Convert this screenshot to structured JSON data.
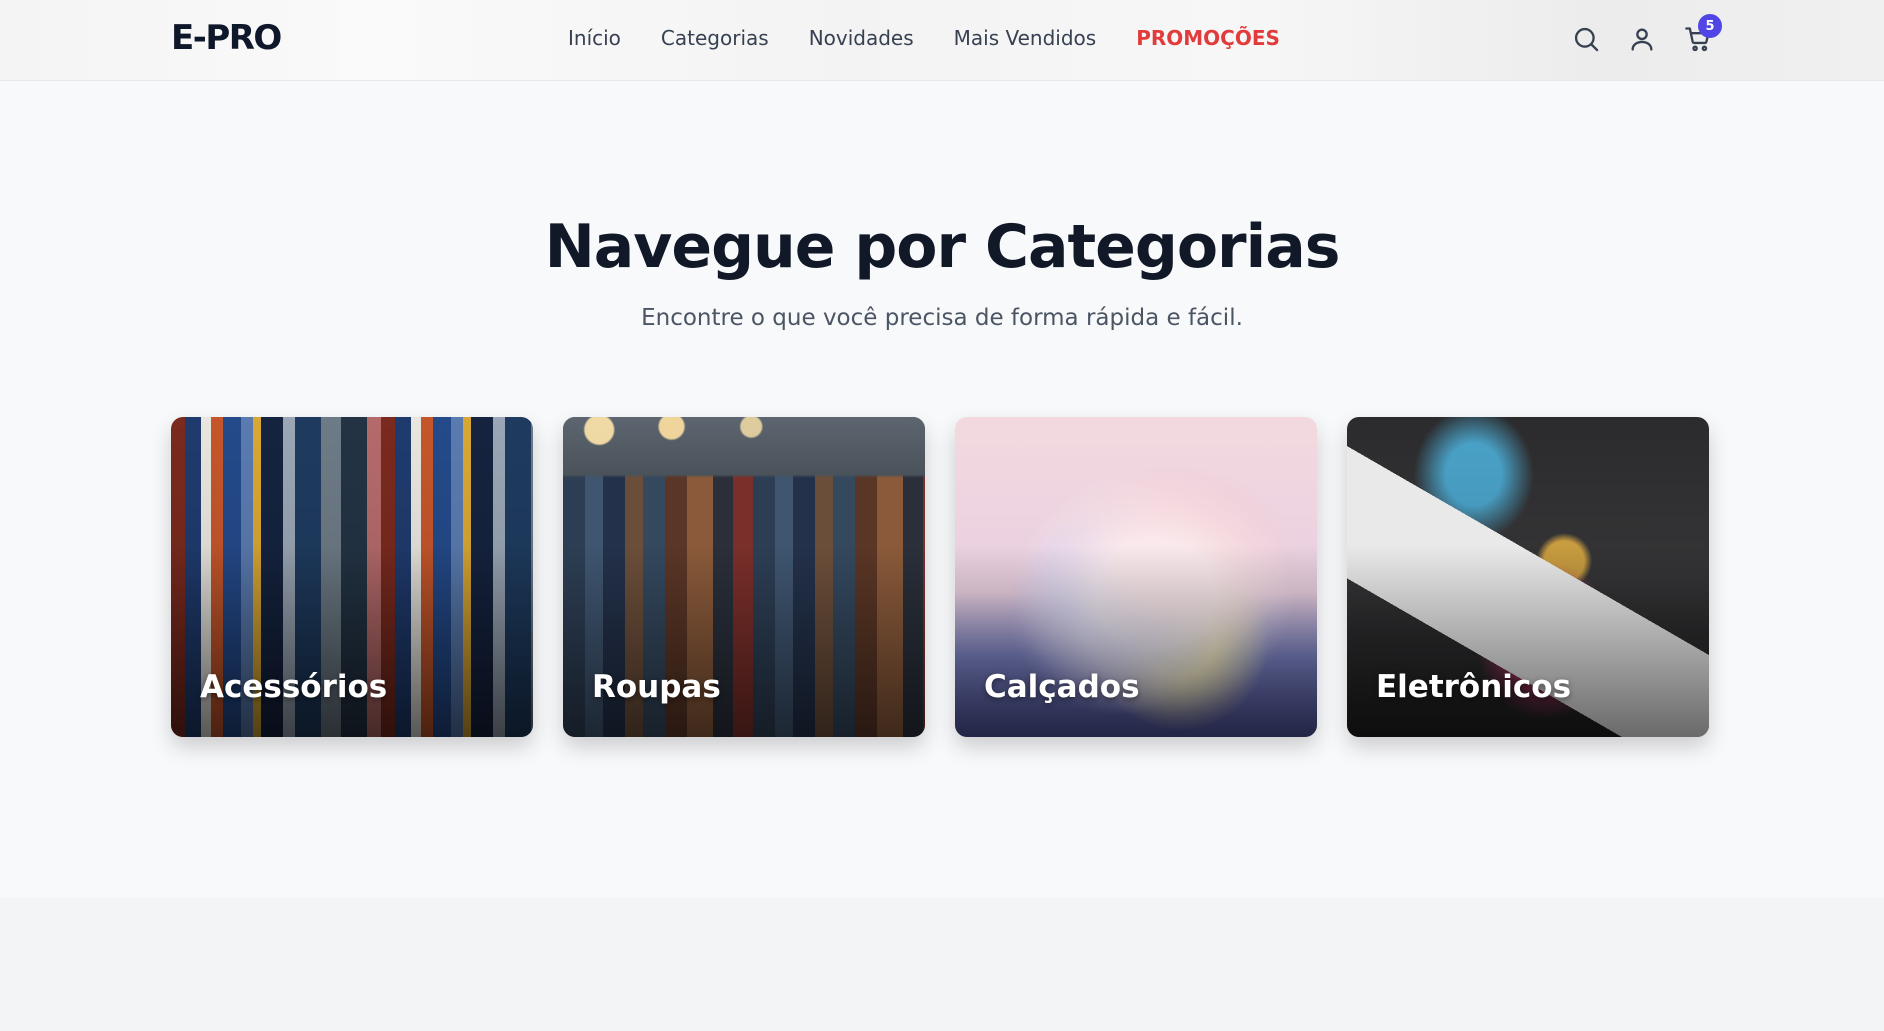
{
  "header": {
    "logo": "E-PRO",
    "nav": [
      {
        "label": "Início",
        "promo": false
      },
      {
        "label": "Categorias",
        "promo": false
      },
      {
        "label": "Novidades",
        "promo": false
      },
      {
        "label": "Mais Vendidos",
        "promo": false
      },
      {
        "label": "PROMOÇÕES",
        "promo": true
      }
    ],
    "icons": [
      "search-icon",
      "user-icon",
      "cart-icon"
    ],
    "cart_count": "5"
  },
  "section": {
    "title": "Navegue por Categorias",
    "subtitle": "Encontre o que você precisa de forma rápida e fácil."
  },
  "categories": [
    {
      "label": "Acessórios"
    },
    {
      "label": "Roupas"
    },
    {
      "label": "Calçados"
    },
    {
      "label": "Eletrônicos"
    }
  ],
  "colors": {
    "accent": "#4f46e5",
    "promo": "#e23b3b",
    "heading": "#111827"
  }
}
